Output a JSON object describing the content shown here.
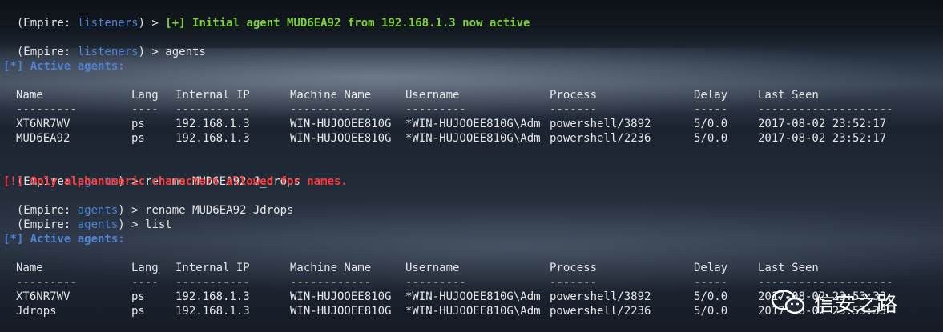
{
  "terminal": {
    "prompt_prefix": "(Empire: ",
    "prompt_suffix": ") > ",
    "line1": {
      "context": "listeners",
      "message": "[+] Initial agent MUD6EA92 from 192.168.1.3 now active"
    },
    "line2": {
      "context": "listeners",
      "command": "agents"
    },
    "active_header_1": "[*] Active agents:",
    "columns": [
      "Name",
      "Lang",
      "Internal IP",
      "Machine Name",
      "Username",
      "Process",
      "Delay",
      "Last Seen"
    ],
    "dash_row": [
      "---------",
      "----",
      "-----------",
      "------------",
      "---------",
      "-------",
      "-----",
      "--------------------"
    ],
    "table1": [
      [
        "XT6NR7WV",
        "ps",
        "192.168.1.3",
        "WIN-HUJOOEE810G",
        "*WIN-HUJOOEE810G\\Adm",
        "powershell/3892",
        "5/0.0",
        "2017-08-02 23:52:17"
      ],
      [
        "MUD6EA92",
        "ps",
        "192.168.1.3",
        "WIN-HUJOOEE810G",
        "*WIN-HUJOOEE810G\\Adm",
        "powershell/2236",
        "5/0.0",
        "2017-08-02 23:52:17"
      ]
    ],
    "cmd_rename1": {
      "context": "agents",
      "command": "rename MUD6EA92 J_drops"
    },
    "error": "[!] Only alphanumeric characters allowed for names.",
    "cmd_rename2": {
      "context": "agents",
      "command": "rename MUD6EA92 Jdrops"
    },
    "cmd_list": {
      "context": "agents",
      "command": "list"
    },
    "active_header_2": "[*] Active agents:",
    "table2": [
      [
        "XT6NR7WV",
        "ps",
        "192.168.1.3",
        "WIN-HUJOOEE810G",
        "*WIN-HUJOOEE810G\\Adm",
        "powershell/3892",
        "5/0.0",
        "2017-08-02 23:53:33"
      ],
      [
        "Jdrops",
        "ps",
        "192.168.1.3",
        "WIN-HUJOOEE810G",
        "*WIN-HUJOOEE810G\\Adm",
        "powershell/2236",
        "5/0.0",
        "2017-08-02 23:53:33"
      ]
    ]
  },
  "watermark": {
    "text": "信安之路",
    "icon": "wechat-icon"
  },
  "colors": {
    "prompt_context": "#4f83d6",
    "success": "#7fd13b",
    "error": "#ff3b3b",
    "text": "#e6e6e6"
  }
}
